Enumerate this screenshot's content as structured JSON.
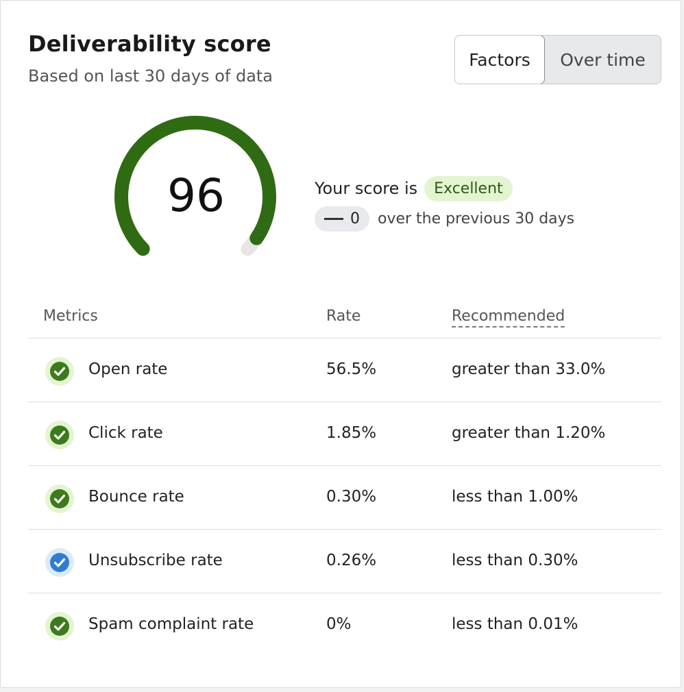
{
  "header": {
    "title": "Deliverability score",
    "subtitle": "Based on last 30 days of data"
  },
  "toggle": {
    "factors_label": "Factors",
    "over_time_label": "Over time"
  },
  "score": {
    "value": "96",
    "progress": 0.96,
    "intro": "Your score is",
    "rating": "Excellent",
    "delta": "0",
    "delta_text": "over the previous 30 days"
  },
  "table": {
    "headers": {
      "metrics": "Metrics",
      "rate": "Rate",
      "recommended": "Recommended"
    },
    "rows": [
      {
        "metric": "Open rate",
        "rate": "56.5%",
        "recommended": "greater than 33.0%",
        "status": "good"
      },
      {
        "metric": "Click rate",
        "rate": "1.85%",
        "recommended": "greater than 1.20%",
        "status": "good"
      },
      {
        "metric": "Bounce rate",
        "rate": "0.30%",
        "recommended": "less than 1.00%",
        "status": "good"
      },
      {
        "metric": "Unsubscribe rate",
        "rate": "0.26%",
        "recommended": "less than 0.30%",
        "status": "info"
      },
      {
        "metric": "Spam complaint rate",
        "rate": "0%",
        "recommended": "less than 0.01%",
        "status": "good"
      }
    ]
  },
  "colors": {
    "gauge_fill": "#2f6b12",
    "gauge_track": "#e6e6e6",
    "good_check": "#3d7a1e",
    "good_ring": "#e4f4d0",
    "info_check": "#2d7ed2",
    "info_ring": "#dcebfa"
  }
}
